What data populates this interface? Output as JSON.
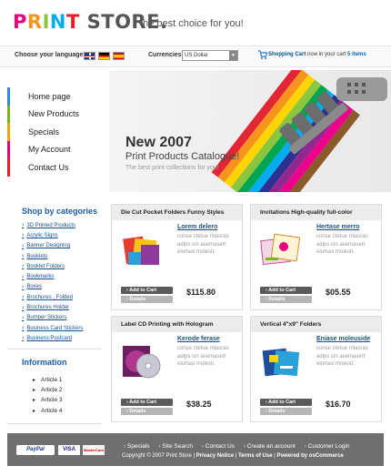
{
  "header": {
    "logo_chars": [
      "P",
      "R",
      "I",
      "N",
      "T"
    ],
    "logo_rest": " STORE.",
    "tagline": "the best choice for you!"
  },
  "topbar": {
    "language_label": "Choose your language:",
    "currencies_label": "Currencies:",
    "currency_value": "US Dollar",
    "cart_label": "Shopping Cart",
    "cart_text": "now in your cart",
    "cart_items": "5 items"
  },
  "nav": {
    "items": [
      {
        "label": "Home page",
        "color": "#2e8bd9"
      },
      {
        "label": "New Products",
        "color": "#7ab51d"
      },
      {
        "label": "Specials",
        "color": "#f0a30a"
      },
      {
        "label": "My Account",
        "color": "#e6007e"
      },
      {
        "label": "Contact Us",
        "color": "#ee1c25"
      }
    ]
  },
  "banner": {
    "title": "New 2007",
    "subtitle": "Print Products Catalogue!",
    "line": "The best print collections for you!"
  },
  "categories": {
    "title": "Shop by categories",
    "items": [
      "3D Printed Products",
      "Acrylic Signs",
      "Banner Designing",
      "Booklets",
      "Booklet Folders",
      "Bookmarks",
      "Boxes",
      "Brochures , Folded",
      "Brochures Holder",
      "Bumper Stickers",
      "Business Card Stickers",
      "Business Postcard"
    ]
  },
  "information": {
    "title": "Information",
    "items": [
      "Article 1",
      "Article 2",
      "Article 3",
      "Article 4"
    ]
  },
  "products": [
    {
      "heading": "Die Cut Pocket Folders Funny Styles",
      "link": "Lorem delero",
      "desc": "conse ctetue mlasras adips cin asemasert elortasi molesti.",
      "price": "$115.80",
      "add": "Add to Cart",
      "details": "Details"
    },
    {
      "heading": "Invitations High-quality full-color",
      "link": "Hertase merro",
      "desc": "conse ctetue mlasras adips cin asemasert elortasi molesti.",
      "price": "$05.55",
      "add": "Add to Cart",
      "details": "Details"
    },
    {
      "heading": "Label CD Printing with Hologram",
      "link": "Kerode ferase",
      "desc": "conse ctetue mlasras adips cin asemasert elortasi molesti.",
      "price": "$38.25",
      "add": "Add to Cart",
      "details": "Details"
    },
    {
      "heading": "Vertical 4\"x9\" Folders",
      "link": "Eniase moleuside",
      "desc": "conse ctetue mlasras adips cin asemasert elortasi molesti.",
      "price": "$16.70",
      "add": "Add to Cart",
      "details": "Details"
    }
  ],
  "footer": {
    "payments": [
      "PayPal",
      "VISA",
      "MasterCard"
    ],
    "links": [
      "Specials",
      "Site Search",
      "Contact Us",
      "Create an account",
      "Customer Login"
    ],
    "copyright": "Copyright © 2007 Print Store",
    "bottom_links": [
      "Privacy Notice",
      "Terms of Use",
      "Powered by osCommerce"
    ]
  }
}
